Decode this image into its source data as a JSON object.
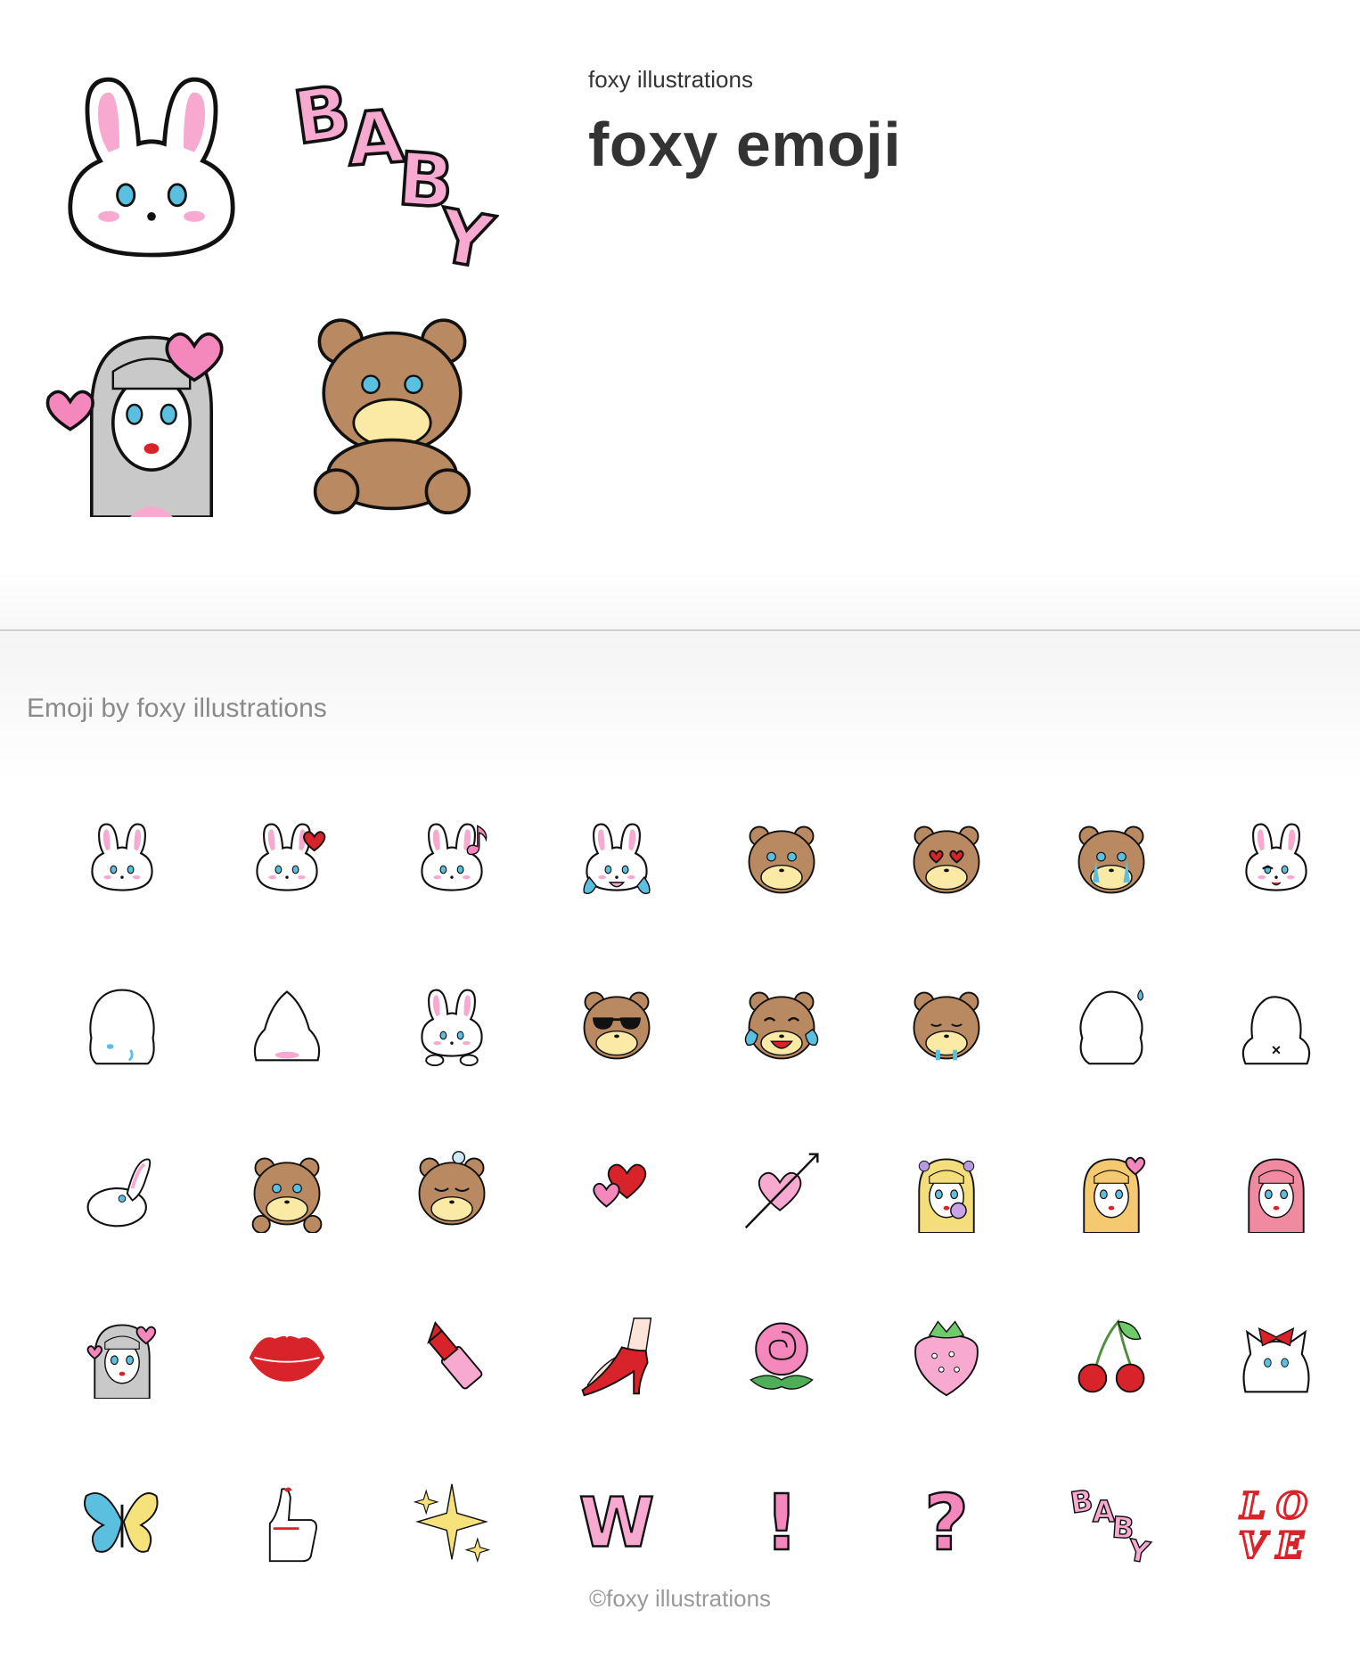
{
  "header": {
    "author": "foxy illustrations",
    "title": "foxy emoji",
    "preview": [
      {
        "icon": "bunny-face-icon"
      },
      {
        "icon": "baby-text-icon"
      },
      {
        "icon": "girl-hearts-icon"
      },
      {
        "icon": "teddy-bear-icon"
      }
    ]
  },
  "list": {
    "heading": "Emoji by foxy illustrations",
    "emojis": [
      {
        "icon": "bunny-face-icon"
      },
      {
        "icon": "bunny-heart-icon"
      },
      {
        "icon": "bunny-music-icon"
      },
      {
        "icon": "bunny-crying-icon"
      },
      {
        "icon": "bear-face-icon"
      },
      {
        "icon": "bear-heart-eyes-icon"
      },
      {
        "icon": "bear-teary-icon"
      },
      {
        "icon": "bunny-wink-icon"
      },
      {
        "icon": "bunny-back-crying-icon"
      },
      {
        "icon": "bunny-hiding-icon"
      },
      {
        "icon": "bunny-sitting-icon"
      },
      {
        "icon": "bear-sunglasses-icon"
      },
      {
        "icon": "bear-laughing-crying-icon"
      },
      {
        "icon": "bear-sad-icon"
      },
      {
        "icon": "bunny-sweat-icon"
      },
      {
        "icon": "bunny-back-icon"
      },
      {
        "icon": "bunny-lying-icon"
      },
      {
        "icon": "teddy-bear-icon"
      },
      {
        "icon": "bear-sleeping-icon"
      },
      {
        "icon": "double-heart-icon"
      },
      {
        "icon": "heart-arrow-icon"
      },
      {
        "icon": "girl-bubblegum-icon"
      },
      {
        "icon": "girl-kiss-icon"
      },
      {
        "icon": "girl-red-hair-icon"
      },
      {
        "icon": "girl-hearts-icon"
      },
      {
        "icon": "lips-icon"
      },
      {
        "icon": "lipstick-icon"
      },
      {
        "icon": "high-heel-icon"
      },
      {
        "icon": "rose-icon"
      },
      {
        "icon": "strawberry-icon"
      },
      {
        "icon": "cherries-icon"
      },
      {
        "icon": "kitten-bow-icon"
      },
      {
        "icon": "butterfly-icon"
      },
      {
        "icon": "thumbs-up-icon"
      },
      {
        "icon": "sparkles-icon"
      },
      {
        "icon": "w-letter-icon"
      },
      {
        "icon": "exclamation-icon"
      },
      {
        "icon": "question-icon"
      },
      {
        "icon": "baby-text-icon"
      },
      {
        "icon": "love-text-icon"
      }
    ]
  },
  "footer": {
    "copyright": "©foxy illustrations"
  },
  "colors": {
    "pink": "#f7a9cf",
    "red": "#d8232a",
    "bear": "#b98a62",
    "cream": "#fbeaa5",
    "heading": "#8a8a8a"
  }
}
